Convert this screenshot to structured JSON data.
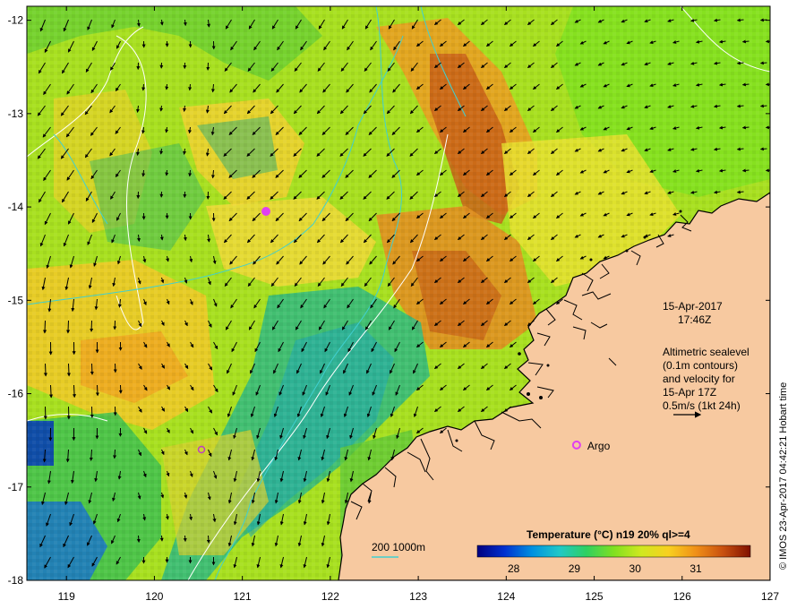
{
  "map": {
    "x_ticks": [
      "119",
      "120",
      "121",
      "122",
      "123",
      "124",
      "125",
      "126",
      "127"
    ],
    "y_ticks": [
      "-12",
      "-13",
      "-14",
      "-15",
      "-16",
      "-17",
      "-18"
    ],
    "extent": {
      "lon_min": 118.55,
      "lon_max": 127.0,
      "lat_min": -18.0,
      "lat_max": -11.85
    }
  },
  "annotation": {
    "date": "15-Apr-2017",
    "time": "17:46Z",
    "altimetry_lines": [
      "Altimetric sealevel",
      "(0.1m contours)",
      "and velocity for",
      "15-Apr 17Z",
      "0.5m/s (1kt 24h)"
    ]
  },
  "argo": {
    "label": "Argo",
    "lon": 124.8,
    "lat": -16.55
  },
  "bathymetry_legend": {
    "label": "200  1000m"
  },
  "colorbar": {
    "title": "Temperature (°C) n19 20% ql>=4",
    "ticks": [
      "28",
      "29",
      "30",
      "31"
    ],
    "range": [
      27.4,
      31.9
    ],
    "colors": [
      "#000080",
      "#0030d0",
      "#0090e0",
      "#20c8c8",
      "#30d060",
      "#80e020",
      "#d0e820",
      "#f8d020",
      "#f09018",
      "#c85010",
      "#801000"
    ]
  },
  "credit": "© IMOS 23-Apr-2017 04:42:21 Hobart time",
  "colors": {
    "land": "#f7c9a0",
    "coast": "#000000",
    "contour": "#ffffff",
    "bathy": "#40d0d0",
    "marker": "#e040f0"
  }
}
